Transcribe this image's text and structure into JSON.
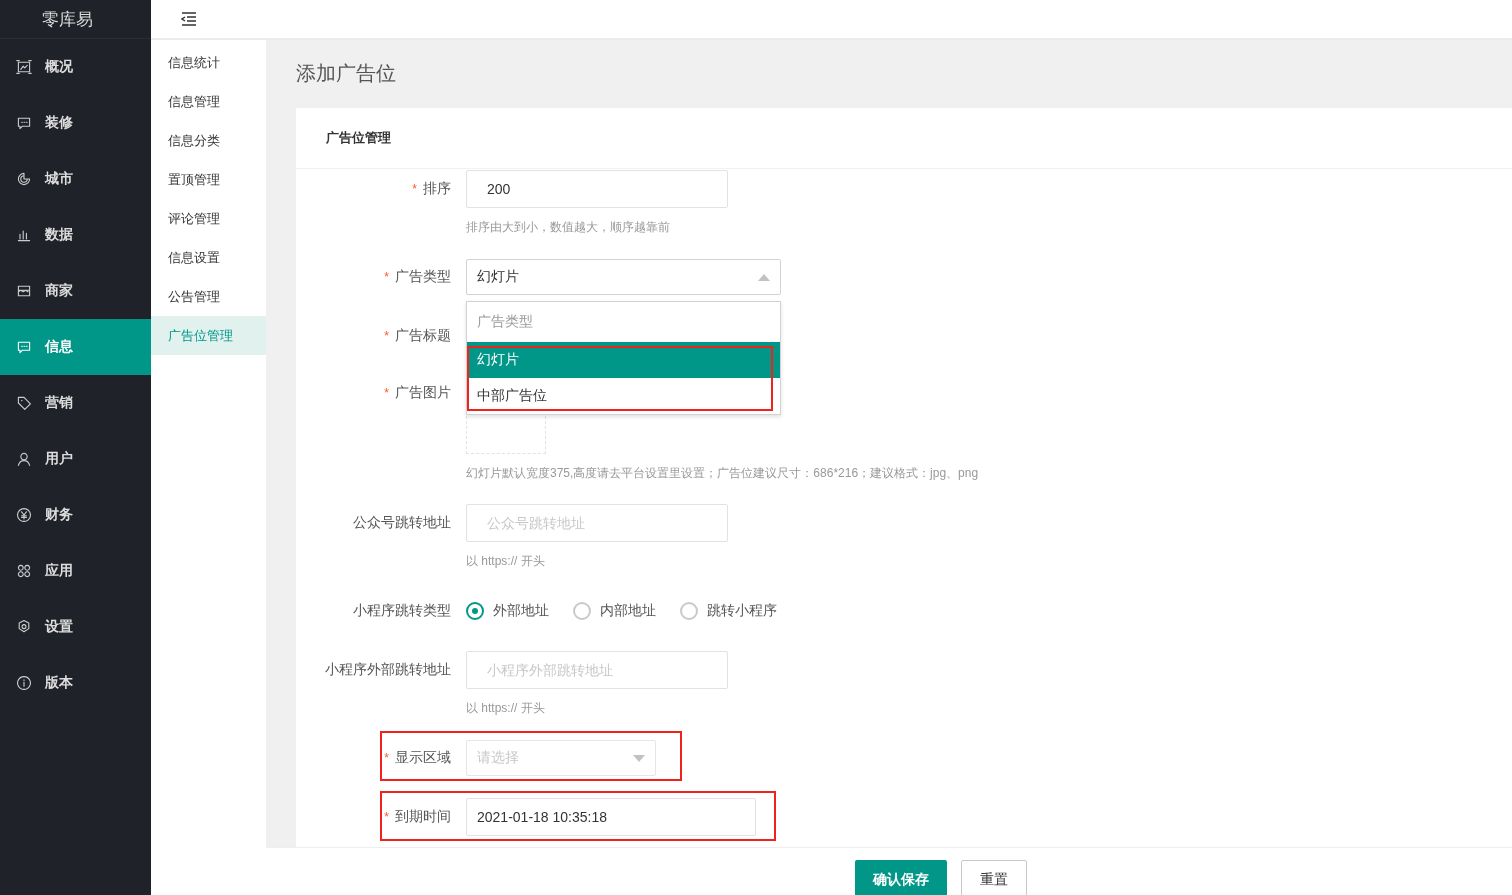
{
  "app": {
    "logo": "零库易"
  },
  "sidebar": {
    "items": [
      {
        "label": "概况",
        "selected": false
      },
      {
        "label": "装修",
        "selected": false
      },
      {
        "label": "城市",
        "selected": false
      },
      {
        "label": "数据",
        "selected": false
      },
      {
        "label": "商家",
        "selected": false
      },
      {
        "label": "信息",
        "selected": true
      },
      {
        "label": "营销",
        "selected": false
      },
      {
        "label": "用户",
        "selected": false
      },
      {
        "label": "财务",
        "selected": false
      },
      {
        "label": "应用",
        "selected": false
      },
      {
        "label": "设置",
        "selected": false
      },
      {
        "label": "版本",
        "selected": false
      }
    ]
  },
  "submenu": {
    "items": [
      {
        "label": "信息统计",
        "selected": false
      },
      {
        "label": "信息管理",
        "selected": false
      },
      {
        "label": "信息分类",
        "selected": false
      },
      {
        "label": "置顶管理",
        "selected": false
      },
      {
        "label": "评论管理",
        "selected": false
      },
      {
        "label": "信息设置",
        "selected": false
      },
      {
        "label": "公告管理",
        "selected": false
      },
      {
        "label": "广告位管理",
        "selected": true
      }
    ]
  },
  "page": {
    "title": "添加广告位"
  },
  "form": {
    "title": "广告位管理",
    "fields": [
      {
        "kind": "input",
        "label": "排序",
        "required_mark": "*",
        "value": "200",
        "hint": "排序由大到小，数值越大，顺序越靠前"
      },
      {
        "kind": "select",
        "label": "广告类型",
        "required_mark": "*",
        "value": "幻灯片",
        "expanded": true,
        "annotated": true,
        "options_header": "广告类型",
        "options": [
          {
            "label": "幻灯片",
            "selected": true
          },
          {
            "label": "中部广告位",
            "selected": false
          }
        ]
      },
      {
        "kind": "covered",
        "label": "广告标题",
        "required_mark": "*"
      },
      {
        "kind": "upload",
        "label": "广告图片",
        "required_mark": "*",
        "hint": "幻灯片默认宽度375,高度请去平台设置里设置；广告位建议尺寸：686*216；建议格式：jpg、png"
      },
      {
        "kind": "input",
        "label": "公众号跳转地址",
        "placeholder": "公众号跳转地址",
        "hint": "以 https:// 开头"
      },
      {
        "kind": "radio",
        "label": "小程序跳转类型",
        "options": [
          {
            "label": "外部地址",
            "selected": true
          },
          {
            "label": "内部地址",
            "selected": false
          },
          {
            "label": "跳转小程序",
            "selected": false
          }
        ]
      },
      {
        "kind": "input",
        "label": "小程序外部跳转地址",
        "placeholder": "小程序外部跳转地址",
        "hint": "以 https:// 开头"
      },
      {
        "kind": "select",
        "label": "显示区域",
        "required_mark": "*",
        "placeholder": "请选择",
        "expanded": false,
        "annotated": true
      },
      {
        "kind": "input",
        "label": "到期时间",
        "required_mark": "*",
        "value": "2021-01-18 10:35:18",
        "annotated": true
      }
    ]
  },
  "footer": {
    "buttons": [
      {
        "label": "确认保存",
        "kind": "primary"
      },
      {
        "label": "重置",
        "kind": "default"
      }
    ]
  }
}
